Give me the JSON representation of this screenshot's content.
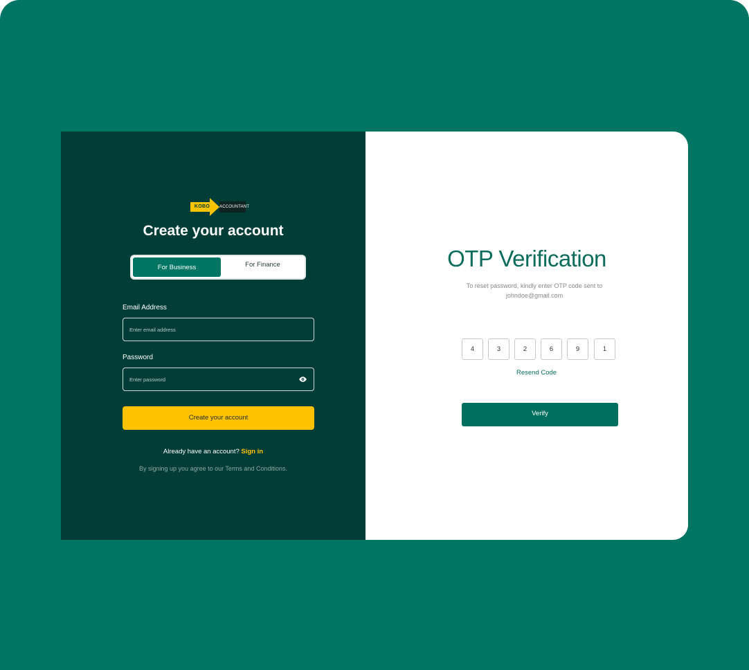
{
  "signup": {
    "logo": {
      "brand": "KOBO",
      "sub": "ACCOUNTANT"
    },
    "title": "Create your account",
    "toggle": {
      "options": [
        {
          "label": "For Business",
          "active": true
        },
        {
          "label": "For Finance",
          "active": false
        }
      ]
    },
    "email": {
      "label": "Email Address",
      "placeholder": "Enter email address",
      "value": ""
    },
    "password": {
      "label": "Password",
      "placeholder": "Enter password",
      "value": "",
      "toggle_icon": "eye-icon"
    },
    "submit_label": "Create your account",
    "signin_prompt": "Already have an account?",
    "signin_link": "Sign in",
    "terms": "By signing up you agree to our Terms and Conditions."
  },
  "otp": {
    "title": "OTP Verification",
    "description": "To reset password, kindly enter OTP code sent to johndoe@gmail.com",
    "digits": [
      "4",
      "3",
      "2",
      "6",
      "9",
      "1"
    ],
    "resend_label": "Resend Code",
    "verify_label": "Verify"
  },
  "colors": {
    "background": "#007563",
    "left_panel": "#003d36",
    "accent_yellow": "#fec200",
    "primary_green": "#006e5e"
  }
}
